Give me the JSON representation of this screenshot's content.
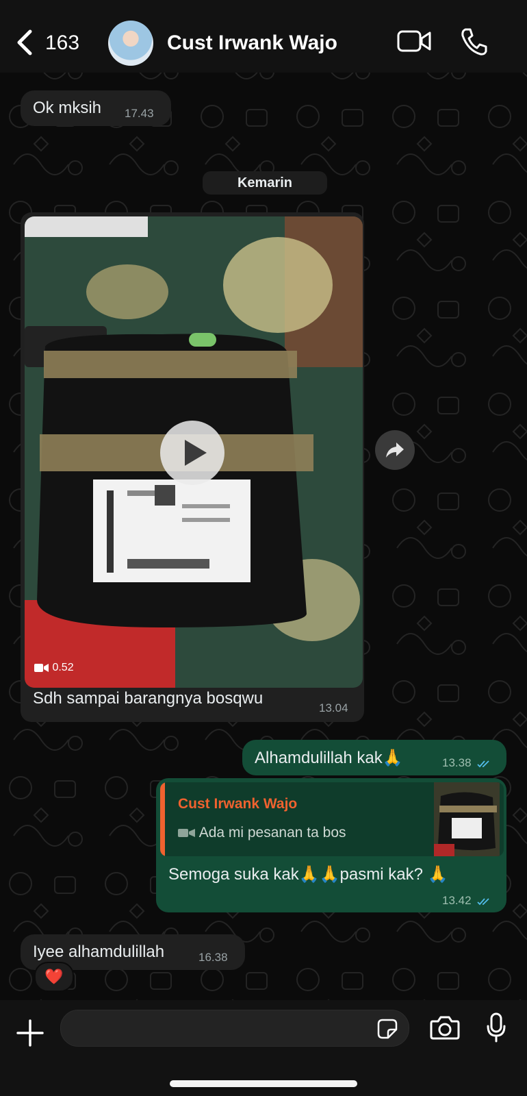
{
  "header": {
    "back_count": "163",
    "contact_name": "Cust Irwank Wajo"
  },
  "date_separator": "Kemarin",
  "messages": [
    {
      "direction": "in",
      "text": "Ok mksih",
      "time": "17.43"
    },
    {
      "direction": "in",
      "type": "video",
      "duration": "0.52",
      "caption": "Sdh sampai barangnya bosqwu",
      "time": "13.04"
    },
    {
      "direction": "out",
      "text": "Alhamdulillah kak🙏",
      "time": "13.38",
      "status": "read"
    },
    {
      "direction": "out",
      "reply_to": {
        "name": "Cust Irwank Wajo",
        "text": "Ada mi pesanan ta bos"
      },
      "text": "Semoga suka kak🙏🙏pasmi kak? 🙏",
      "time": "13.42",
      "status": "read"
    },
    {
      "direction": "in",
      "text": "Iyee alhamdulillah",
      "time": "16.38",
      "reaction": "❤️"
    }
  ],
  "composer": {
    "placeholder": ""
  },
  "colors": {
    "background": "#0b0b0b",
    "incoming_bubble": "#202020",
    "outgoing_bubble": "#134d37",
    "quote_accent": "#f0622f",
    "read_ticks": "#53bdeb"
  },
  "icons": [
    "back-chevron-icon",
    "video-call-icon",
    "phone-icon",
    "play-icon",
    "video-camera-icon",
    "forward-icon",
    "plus-icon",
    "sticker-icon",
    "camera-icon",
    "microphone-icon",
    "double-check-icon"
  ]
}
